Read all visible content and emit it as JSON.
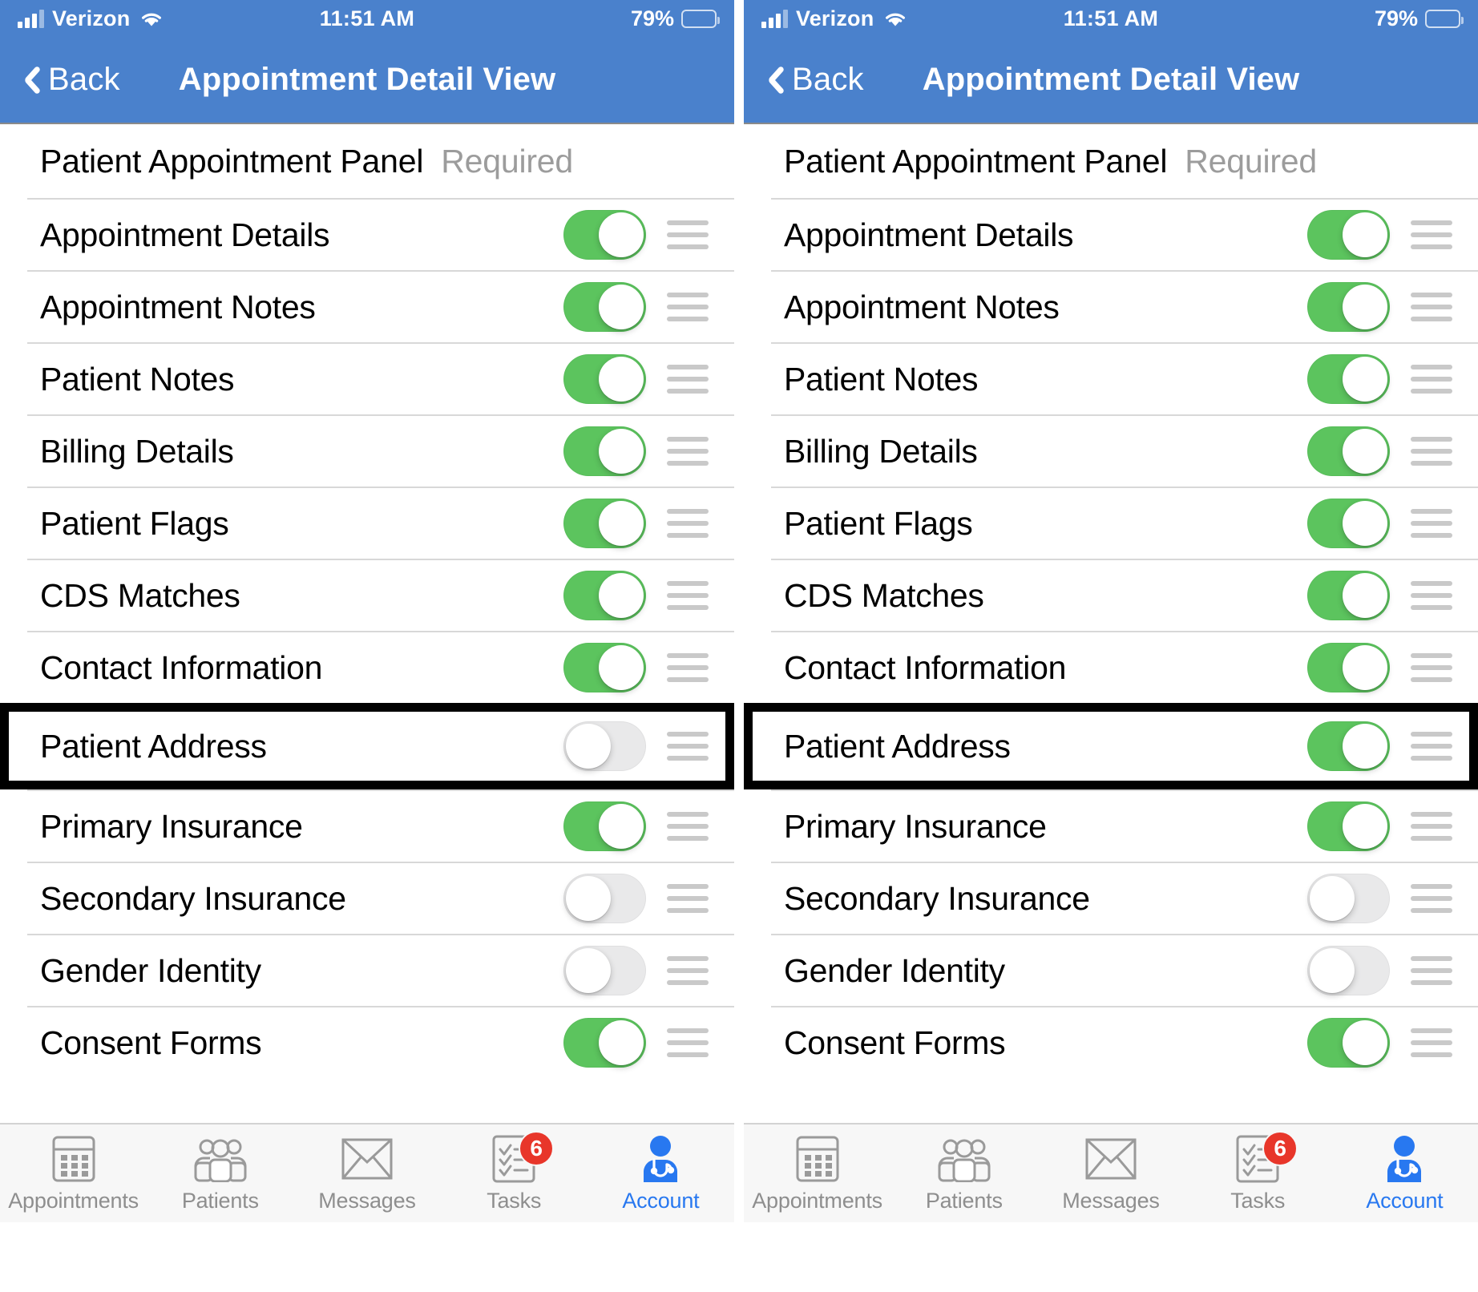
{
  "status_bar": {
    "carrier": "Verizon",
    "time": "11:51 AM",
    "battery_pct": "79%",
    "signal_icon": "cellular-signal-icon",
    "wifi_icon": "wifi-icon",
    "battery_icon": "battery-icon"
  },
  "nav": {
    "back_label": "Back",
    "title": "Appointment Detail View",
    "back_icon": "chevron-left-icon",
    "bar_color": "#4a81cc"
  },
  "section": {
    "title": "Patient Appointment Panel",
    "required_label": "Required"
  },
  "colors": {
    "toggle_on": "#5cc45e",
    "toggle_off": "#e9e9ea",
    "accent": "#2878f0",
    "badge": "#e8362a",
    "highlight_outline": "#000000"
  },
  "panels": [
    {
      "id": "left-panel",
      "rows": [
        {
          "label": "Appointment Details",
          "enabled": true,
          "highlighted": false
        },
        {
          "label": "Appointment Notes",
          "enabled": true,
          "highlighted": false
        },
        {
          "label": "Patient Notes",
          "enabled": true,
          "highlighted": false
        },
        {
          "label": "Billing Details",
          "enabled": true,
          "highlighted": false
        },
        {
          "label": "Patient Flags",
          "enabled": true,
          "highlighted": false
        },
        {
          "label": "CDS Matches",
          "enabled": true,
          "highlighted": false
        },
        {
          "label": "Contact Information",
          "enabled": true,
          "highlighted": false
        },
        {
          "label": "Patient Address",
          "enabled": false,
          "highlighted": true
        },
        {
          "label": "Primary Insurance",
          "enabled": true,
          "highlighted": false
        },
        {
          "label": "Secondary Insurance",
          "enabled": false,
          "highlighted": false
        },
        {
          "label": "Gender Identity",
          "enabled": false,
          "highlighted": false
        },
        {
          "label": "Consent Forms",
          "enabled": true,
          "highlighted": false
        }
      ]
    },
    {
      "id": "right-panel",
      "rows": [
        {
          "label": "Appointment Details",
          "enabled": true,
          "highlighted": false
        },
        {
          "label": "Appointment Notes",
          "enabled": true,
          "highlighted": false
        },
        {
          "label": "Patient Notes",
          "enabled": true,
          "highlighted": false
        },
        {
          "label": "Billing Details",
          "enabled": true,
          "highlighted": false
        },
        {
          "label": "Patient Flags",
          "enabled": true,
          "highlighted": false
        },
        {
          "label": "CDS Matches",
          "enabled": true,
          "highlighted": false
        },
        {
          "label": "Contact Information",
          "enabled": true,
          "highlighted": false
        },
        {
          "label": "Patient Address",
          "enabled": true,
          "highlighted": true
        },
        {
          "label": "Primary Insurance",
          "enabled": true,
          "highlighted": false
        },
        {
          "label": "Secondary Insurance",
          "enabled": false,
          "highlighted": false
        },
        {
          "label": "Gender Identity",
          "enabled": false,
          "highlighted": false
        },
        {
          "label": "Consent Forms",
          "enabled": true,
          "highlighted": false
        }
      ]
    }
  ],
  "tabbar": {
    "items": [
      {
        "label": "Appointments",
        "icon": "calendar-icon",
        "active": false,
        "badge": null
      },
      {
        "label": "Patients",
        "icon": "people-icon",
        "active": false,
        "badge": null
      },
      {
        "label": "Messages",
        "icon": "envelope-icon",
        "active": false,
        "badge": null
      },
      {
        "label": "Tasks",
        "icon": "checklist-icon",
        "active": false,
        "badge": "6"
      },
      {
        "label": "Account",
        "icon": "doctor-icon",
        "active": true,
        "badge": null
      }
    ]
  }
}
